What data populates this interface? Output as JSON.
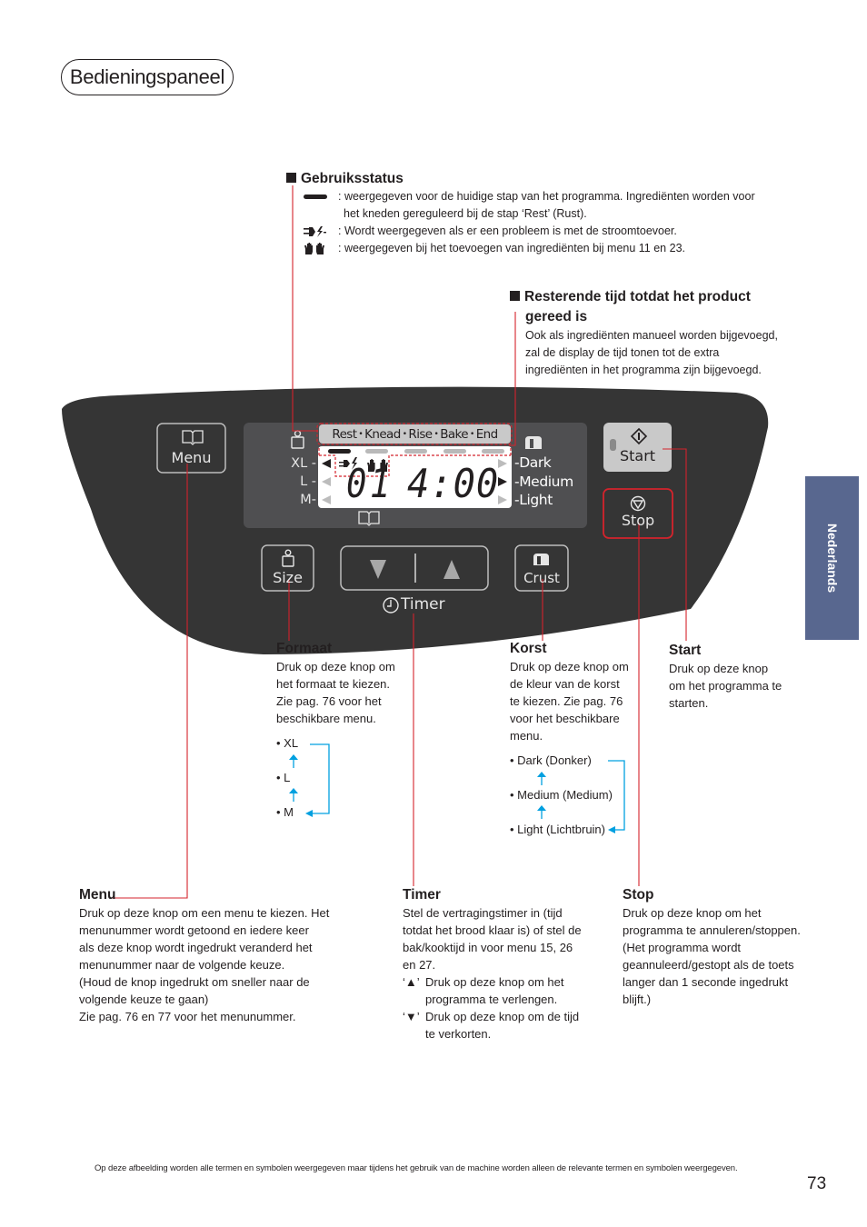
{
  "page": {
    "title": "Bedieningspaneel",
    "side_tab": "Nederlands",
    "page_number": "73",
    "footnote": "Op deze afbeelding worden alle termen en symbolen weergegeven maar tijdens het gebruik van de machine worden alleen de relevante termen en symbolen weergegeven."
  },
  "status_section": {
    "heading": "Gebruiksstatus",
    "items": [
      {
        "icon": "progress-bar-icon",
        "text": ": weergegeven voor de huidige stap van het programma. Ingrediënten worden voor",
        "text2": "het kneden gereguleerd bij de stap ‘Rest’ (Rust)."
      },
      {
        "icon": "power-failure-icon",
        "text": ": Wordt weergegeven als er een probleem is met de stroomtoevoer."
      },
      {
        "icon": "hands-icon",
        "text": ": weergegeven bij het toevoegen van ingrediënten bij menu 11 en 23."
      }
    ]
  },
  "remaining_section": {
    "heading_line1": "Resterende tijd totdat het product",
    "heading_line2": "gereed is",
    "body": [
      "Ook als ingrediënten manueel worden bijgevoegd,",
      "zal de display de tijd tonen tot de extra",
      "ingrediënten in het programma zijn bijgevoegd."
    ]
  },
  "panel": {
    "menu_button": "Menu",
    "size_button": "Size",
    "crust_button": "Crust",
    "start_button": "Start",
    "stop_button": "Stop",
    "timer_label": "Timer",
    "timer_down": "▼",
    "timer_up": "▲",
    "display": {
      "stages": [
        "Rest",
        "Knead",
        "Rise",
        "Bake",
        "End"
      ],
      "active_stage": "Rest",
      "sizes": [
        "XL",
        "L",
        "M"
      ],
      "active_size": "XL",
      "crusts": [
        "Dark",
        "Medium",
        "Light"
      ],
      "active_crust": "Medium",
      "menu_number": "01",
      "time": "4:00"
    }
  },
  "callouts": {
    "formaat": {
      "heading": "Formaat",
      "body": [
        "Druk op deze knop om",
        "het formaat te kiezen.",
        "Zie pag. 76 voor het",
        "beschikbare menu."
      ],
      "options": [
        "• XL",
        "• L",
        "• M"
      ]
    },
    "korst": {
      "heading": "Korst",
      "body": [
        "Druk op deze knop om",
        "de kleur van de korst",
        "te kiezen. Zie pag. 76",
        "voor het beschikbare",
        "menu."
      ],
      "options": [
        "• Dark (Donker)",
        "• Medium (Medium)",
        "• Light (Lichtbruin)"
      ]
    },
    "start": {
      "heading": "Start",
      "body": [
        "Druk op deze knop",
        "om het programma te",
        "starten."
      ]
    },
    "menu": {
      "heading": "Menu",
      "body": [
        "Druk op deze knop om een menu te kiezen. Het",
        "menunummer wordt getoond en iedere keer",
        "als deze knop wordt ingedrukt veranderd het",
        "menunummer naar de volgende keuze.",
        "(Houd de knop ingedrukt om sneller naar de",
        "volgende keuze te gaan)",
        "Zie pag. 76 en 77 voor het menunummer."
      ]
    },
    "timer": {
      "heading": "Timer",
      "body": [
        "Stel de vertragingstimer in (tijd",
        "totdat het brood klaar is) of stel de",
        "bak/kooktijd in voor menu 15, 26",
        "en 27."
      ],
      "up_key": "‘▲’",
      "up_text": [
        "Druk op deze knop om het",
        "programma te verlengen."
      ],
      "down_key": "‘▼’",
      "down_text": [
        "Druk op deze knop om de tijd",
        "te verkorten."
      ]
    },
    "stop": {
      "heading": "Stop",
      "body": [
        "Druk op deze knop om het",
        "programma te annuleren/stoppen.",
        "(Het programma wordt",
        "geannuleerd/gestopt als de toets",
        "langer dan 1 seconde ingedrukt",
        "blijft.)"
      ]
    }
  },
  "colors": {
    "leader_red": "#d4232c",
    "arrow_blue": "#00a0e0",
    "panel_dark": "#353535",
    "tab_blue": "#58678f"
  }
}
